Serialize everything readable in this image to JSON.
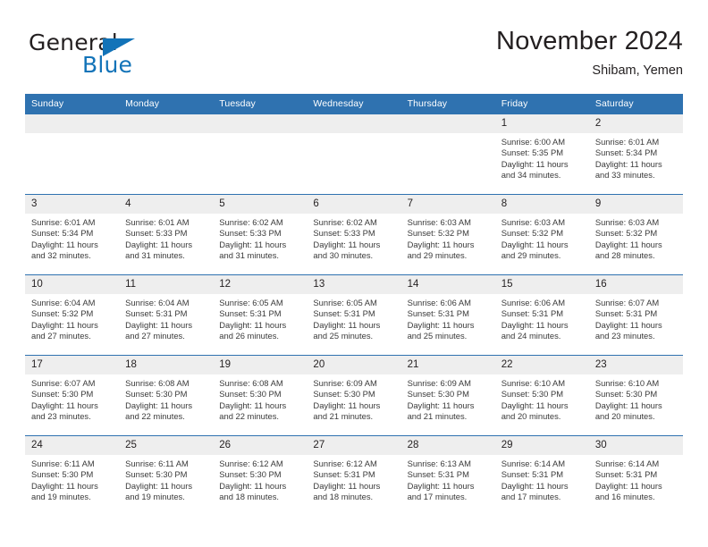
{
  "brand": {
    "name_top": "General",
    "name_bottom": "Blue",
    "triangle_color": "#1273b8",
    "text_color": "#231f20"
  },
  "header": {
    "title": "November 2024",
    "location": "Shibam, Yemen"
  },
  "theme": {
    "header_blue": "#2f72b0",
    "daynum_band": "#eeeeee",
    "row_rule": "#2f72b0",
    "body_text": "#3a3a3a"
  },
  "weekdays": [
    "Sunday",
    "Monday",
    "Tuesday",
    "Wednesday",
    "Thursday",
    "Friday",
    "Saturday"
  ],
  "labels": {
    "sunrise_prefix": "Sunrise:",
    "sunset_prefix": "Sunset:",
    "daylight_prefix": "Daylight:"
  },
  "weeks": [
    [
      {
        "empty": true,
        "day": ""
      },
      {
        "empty": true,
        "day": ""
      },
      {
        "empty": true,
        "day": ""
      },
      {
        "empty": true,
        "day": ""
      },
      {
        "empty": true,
        "day": ""
      },
      {
        "empty": false,
        "day": "1",
        "sunrise": "Sunrise: 6:00 AM",
        "sunset": "Sunset: 5:35 PM",
        "daylight_l1": "Daylight: 11 hours",
        "daylight_l2": "and 34 minutes."
      },
      {
        "empty": false,
        "day": "2",
        "sunrise": "Sunrise: 6:01 AM",
        "sunset": "Sunset: 5:34 PM",
        "daylight_l1": "Daylight: 11 hours",
        "daylight_l2": "and 33 minutes."
      }
    ],
    [
      {
        "empty": false,
        "day": "3",
        "sunrise": "Sunrise: 6:01 AM",
        "sunset": "Sunset: 5:34 PM",
        "daylight_l1": "Daylight: 11 hours",
        "daylight_l2": "and 32 minutes."
      },
      {
        "empty": false,
        "day": "4",
        "sunrise": "Sunrise: 6:01 AM",
        "sunset": "Sunset: 5:33 PM",
        "daylight_l1": "Daylight: 11 hours",
        "daylight_l2": "and 31 minutes."
      },
      {
        "empty": false,
        "day": "5",
        "sunrise": "Sunrise: 6:02 AM",
        "sunset": "Sunset: 5:33 PM",
        "daylight_l1": "Daylight: 11 hours",
        "daylight_l2": "and 31 minutes."
      },
      {
        "empty": false,
        "day": "6",
        "sunrise": "Sunrise: 6:02 AM",
        "sunset": "Sunset: 5:33 PM",
        "daylight_l1": "Daylight: 11 hours",
        "daylight_l2": "and 30 minutes."
      },
      {
        "empty": false,
        "day": "7",
        "sunrise": "Sunrise: 6:03 AM",
        "sunset": "Sunset: 5:32 PM",
        "daylight_l1": "Daylight: 11 hours",
        "daylight_l2": "and 29 minutes."
      },
      {
        "empty": false,
        "day": "8",
        "sunrise": "Sunrise: 6:03 AM",
        "sunset": "Sunset: 5:32 PM",
        "daylight_l1": "Daylight: 11 hours",
        "daylight_l2": "and 29 minutes."
      },
      {
        "empty": false,
        "day": "9",
        "sunrise": "Sunrise: 6:03 AM",
        "sunset": "Sunset: 5:32 PM",
        "daylight_l1": "Daylight: 11 hours",
        "daylight_l2": "and 28 minutes."
      }
    ],
    [
      {
        "empty": false,
        "day": "10",
        "sunrise": "Sunrise: 6:04 AM",
        "sunset": "Sunset: 5:32 PM",
        "daylight_l1": "Daylight: 11 hours",
        "daylight_l2": "and 27 minutes."
      },
      {
        "empty": false,
        "day": "11",
        "sunrise": "Sunrise: 6:04 AM",
        "sunset": "Sunset: 5:31 PM",
        "daylight_l1": "Daylight: 11 hours",
        "daylight_l2": "and 27 minutes."
      },
      {
        "empty": false,
        "day": "12",
        "sunrise": "Sunrise: 6:05 AM",
        "sunset": "Sunset: 5:31 PM",
        "daylight_l1": "Daylight: 11 hours",
        "daylight_l2": "and 26 minutes."
      },
      {
        "empty": false,
        "day": "13",
        "sunrise": "Sunrise: 6:05 AM",
        "sunset": "Sunset: 5:31 PM",
        "daylight_l1": "Daylight: 11 hours",
        "daylight_l2": "and 25 minutes."
      },
      {
        "empty": false,
        "day": "14",
        "sunrise": "Sunrise: 6:06 AM",
        "sunset": "Sunset: 5:31 PM",
        "daylight_l1": "Daylight: 11 hours",
        "daylight_l2": "and 25 minutes."
      },
      {
        "empty": false,
        "day": "15",
        "sunrise": "Sunrise: 6:06 AM",
        "sunset": "Sunset: 5:31 PM",
        "daylight_l1": "Daylight: 11 hours",
        "daylight_l2": "and 24 minutes."
      },
      {
        "empty": false,
        "day": "16",
        "sunrise": "Sunrise: 6:07 AM",
        "sunset": "Sunset: 5:31 PM",
        "daylight_l1": "Daylight: 11 hours",
        "daylight_l2": "and 23 minutes."
      }
    ],
    [
      {
        "empty": false,
        "day": "17",
        "sunrise": "Sunrise: 6:07 AM",
        "sunset": "Sunset: 5:30 PM",
        "daylight_l1": "Daylight: 11 hours",
        "daylight_l2": "and 23 minutes."
      },
      {
        "empty": false,
        "day": "18",
        "sunrise": "Sunrise: 6:08 AM",
        "sunset": "Sunset: 5:30 PM",
        "daylight_l1": "Daylight: 11 hours",
        "daylight_l2": "and 22 minutes."
      },
      {
        "empty": false,
        "day": "19",
        "sunrise": "Sunrise: 6:08 AM",
        "sunset": "Sunset: 5:30 PM",
        "daylight_l1": "Daylight: 11 hours",
        "daylight_l2": "and 22 minutes."
      },
      {
        "empty": false,
        "day": "20",
        "sunrise": "Sunrise: 6:09 AM",
        "sunset": "Sunset: 5:30 PM",
        "daylight_l1": "Daylight: 11 hours",
        "daylight_l2": "and 21 minutes."
      },
      {
        "empty": false,
        "day": "21",
        "sunrise": "Sunrise: 6:09 AM",
        "sunset": "Sunset: 5:30 PM",
        "daylight_l1": "Daylight: 11 hours",
        "daylight_l2": "and 21 minutes."
      },
      {
        "empty": false,
        "day": "22",
        "sunrise": "Sunrise: 6:10 AM",
        "sunset": "Sunset: 5:30 PM",
        "daylight_l1": "Daylight: 11 hours",
        "daylight_l2": "and 20 minutes."
      },
      {
        "empty": false,
        "day": "23",
        "sunrise": "Sunrise: 6:10 AM",
        "sunset": "Sunset: 5:30 PM",
        "daylight_l1": "Daylight: 11 hours",
        "daylight_l2": "and 20 minutes."
      }
    ],
    [
      {
        "empty": false,
        "day": "24",
        "sunrise": "Sunrise: 6:11 AM",
        "sunset": "Sunset: 5:30 PM",
        "daylight_l1": "Daylight: 11 hours",
        "daylight_l2": "and 19 minutes."
      },
      {
        "empty": false,
        "day": "25",
        "sunrise": "Sunrise: 6:11 AM",
        "sunset": "Sunset: 5:30 PM",
        "daylight_l1": "Daylight: 11 hours",
        "daylight_l2": "and 19 minutes."
      },
      {
        "empty": false,
        "day": "26",
        "sunrise": "Sunrise: 6:12 AM",
        "sunset": "Sunset: 5:30 PM",
        "daylight_l1": "Daylight: 11 hours",
        "daylight_l2": "and 18 minutes."
      },
      {
        "empty": false,
        "day": "27",
        "sunrise": "Sunrise: 6:12 AM",
        "sunset": "Sunset: 5:31 PM",
        "daylight_l1": "Daylight: 11 hours",
        "daylight_l2": "and 18 minutes."
      },
      {
        "empty": false,
        "day": "28",
        "sunrise": "Sunrise: 6:13 AM",
        "sunset": "Sunset: 5:31 PM",
        "daylight_l1": "Daylight: 11 hours",
        "daylight_l2": "and 17 minutes."
      },
      {
        "empty": false,
        "day": "29",
        "sunrise": "Sunrise: 6:14 AM",
        "sunset": "Sunset: 5:31 PM",
        "daylight_l1": "Daylight: 11 hours",
        "daylight_l2": "and 17 minutes."
      },
      {
        "empty": false,
        "day": "30",
        "sunrise": "Sunrise: 6:14 AM",
        "sunset": "Sunset: 5:31 PM",
        "daylight_l1": "Daylight: 11 hours",
        "daylight_l2": "and 16 minutes."
      }
    ]
  ]
}
